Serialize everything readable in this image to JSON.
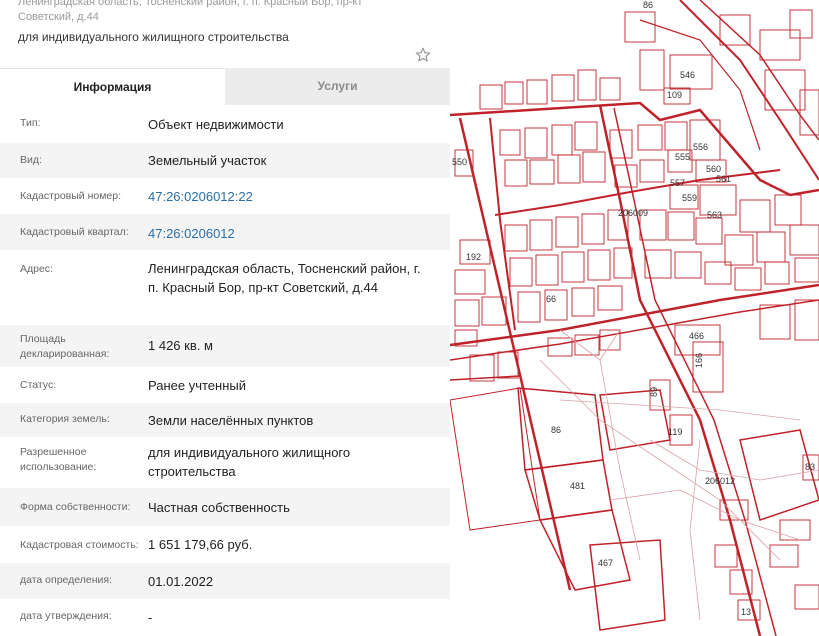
{
  "header": {
    "address": "Ленинградская область, Тосненский район, г. п. Красный Бор, пр-кт Советский, д.44",
    "purpose": "для индивидуального жилищного строительства"
  },
  "tabs": [
    {
      "label": "Информация",
      "active": true
    },
    {
      "label": "Услуги",
      "active": false
    }
  ],
  "rows": [
    {
      "label": "Тип:",
      "value": "Объект недвижимости"
    },
    {
      "label": "Вид:",
      "value": "Земельный участок"
    },
    {
      "label": "Кадастровый номер:",
      "value": "47:26:0206012:22"
    },
    {
      "label": "Кадастровый квартал:",
      "value": "47:26:0206012"
    },
    {
      "label": "Адрес:",
      "value": "Ленинградская область, Тосненский район, г. п. Красный Бор, пр-кт Советский, д.44"
    },
    {
      "label": "Площадь декларированная:",
      "value": "1 426 кв. м"
    },
    {
      "label": "Статус:",
      "value": "Ранее учтенный"
    },
    {
      "label": "Категория земель:",
      "value": "Земли населённых пунктов"
    },
    {
      "label": "Разрешенное использование:",
      "value": "для индивидуального жилищного строительства"
    },
    {
      "label": "Форма собственности:",
      "value": "Частная собственность"
    },
    {
      "label": "Кадастровая стоимость:",
      "value": "1 651 179,66 руб."
    },
    {
      "label": "дата определения:",
      "value": "01.01.2022"
    },
    {
      "label": "дата утверждения:",
      "value": "-"
    }
  ],
  "map": {
    "labels": [
      "86",
      "546",
      "109",
      "550",
      "555",
      "556",
      "560",
      "561",
      "557",
      "559",
      "563",
      "206009",
      "192",
      "66",
      "466",
      "166",
      "89",
      "86",
      "119",
      "206012",
      "481",
      "467",
      "83",
      "13"
    ]
  },
  "colors": {
    "link": "#2a6fa8",
    "parcel": "#c0222a",
    "tab_inactive": "#ececec"
  }
}
